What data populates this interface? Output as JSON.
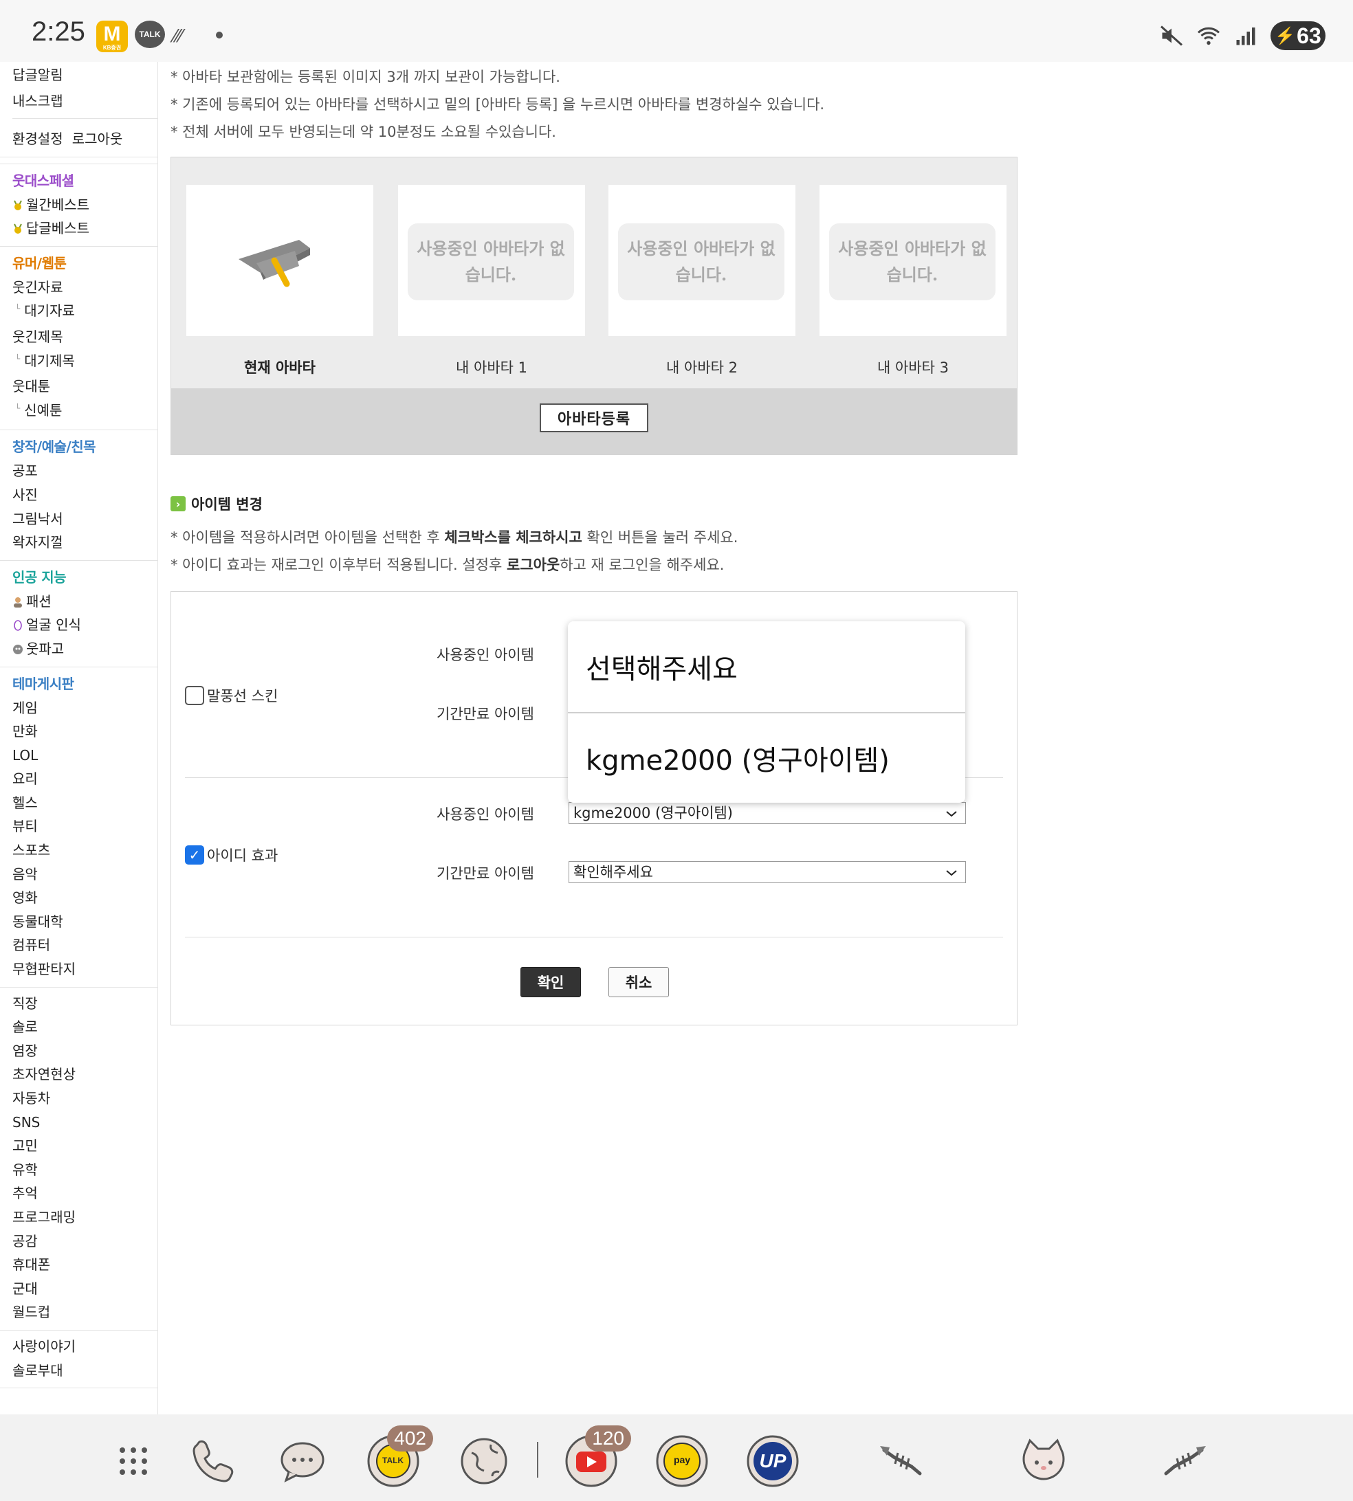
{
  "status_bar": {
    "time": "2:25",
    "kb_app_letter": "M",
    "kb_app_sub": "KB증권",
    "talk_label": "TALK",
    "battery": "63"
  },
  "sidebar": {
    "top_items": [
      "답글알림",
      "내스크랩"
    ],
    "settings": "환경설정",
    "logout": "로그아웃",
    "groups": [
      {
        "title": "웃대스페셜",
        "color": "#9b4dca",
        "items": [
          {
            "label": "월간베스트",
            "icon": "medal-icon"
          },
          {
            "label": "답글베스트",
            "icon": "medal-icon"
          }
        ]
      },
      {
        "title": "유머/웹툰",
        "color": "#e07b00",
        "items": [
          {
            "label": "웃긴자료"
          },
          {
            "label": "대기자료",
            "sub": true
          },
          {
            "label": "웃긴제목"
          },
          {
            "label": "대기제목",
            "sub": true
          },
          {
            "label": "웃대툰"
          },
          {
            "label": "신예툰",
            "sub": true
          }
        ]
      },
      {
        "title": "창작/예술/친목",
        "color": "#3a7fc4",
        "items": [
          {
            "label": "공포"
          },
          {
            "label": "사진"
          },
          {
            "label": "그림낙서"
          },
          {
            "label": "왁자지껄"
          }
        ]
      },
      {
        "title": "인공 지능",
        "color": "#1aa39a",
        "items": [
          {
            "label": "패션",
            "icon": "person-icon"
          },
          {
            "label": "얼굴 인식",
            "icon": "face-outline-icon"
          },
          {
            "label": "웃파고",
            "icon": "robot-icon"
          }
        ]
      },
      {
        "title": "테마게시판",
        "color": "#3a7fc4",
        "items": [
          {
            "label": "게임"
          },
          {
            "label": "만화"
          },
          {
            "label": "LOL"
          },
          {
            "label": "요리"
          },
          {
            "label": "헬스"
          },
          {
            "label": "뷰티"
          },
          {
            "label": "스포츠"
          },
          {
            "label": "음악"
          },
          {
            "label": "영화"
          },
          {
            "label": "동물대학"
          },
          {
            "label": "컴퓨터"
          },
          {
            "label": "무협판타지"
          }
        ]
      },
      {
        "title": "",
        "items": [
          {
            "label": "직장"
          },
          {
            "label": "솔로"
          },
          {
            "label": "염장"
          },
          {
            "label": "초자연현상"
          },
          {
            "label": "자동차"
          },
          {
            "label": "SNS"
          },
          {
            "label": "고민"
          },
          {
            "label": "유학"
          },
          {
            "label": "추억"
          },
          {
            "label": "프로그래밍"
          },
          {
            "label": "공감"
          },
          {
            "label": "휴대폰"
          },
          {
            "label": "군대"
          },
          {
            "label": "월드컵"
          }
        ]
      },
      {
        "title": "",
        "items": [
          {
            "label": "사랑이야기"
          },
          {
            "label": "솔로부대"
          }
        ]
      }
    ]
  },
  "avatar_notes": [
    "* 아바타 보관함에는 등록된 이미지 3개 까지 보관이 가능합니다.",
    "* 기존에 등록되어 있는 아바타를 선택하시고 밑의 [아바타 등록] 을 누르시면 아바타를 변경하실수 있습니다.",
    "* 전체 서버에 모두 반영되는데 약 10분정도 소요될 수있습니다."
  ],
  "avatars": {
    "current_label": "현재 아바타",
    "empty_text": "사용중인 아바타가 없습니다.",
    "slots": [
      "내 아바타 1",
      "내 아바타 2",
      "내 아바타 3"
    ],
    "register_button": "아바타등록"
  },
  "item_section": {
    "title": "아이템 변경",
    "note1_pre": "* 아이템을 적용하시려면 아이템을 선택한 후 ",
    "note1_bold": "체크박스를 체크하시고",
    "note1_post": " 확인 버튼을 눌러 주세요.",
    "note2_pre": "* 아이디 효과는 재로그인 이후부터 적용됩니다. 설정후 ",
    "note2_bold": "로그아웃",
    "note2_post": "하고 재 로그인을 해주세요.",
    "rows": [
      {
        "checkbox_label": "말풍선 스킨",
        "checked": false,
        "in_use_label": "사용중인 아이템",
        "expired_label": "기간만료 아이템"
      },
      {
        "checkbox_label": "아이디 효과",
        "checked": true,
        "in_use_label": "사용중인 아이템",
        "in_use_value": "kgme2000 (영구아이템)",
        "expired_label": "기간만료 아이템",
        "expired_value": "확인해주세요"
      }
    ],
    "confirm_button": "확인",
    "cancel_button": "취소",
    "dropdown_options": [
      "선택해주세요",
      "kgme2000 (영구아이템)"
    ]
  },
  "nav": {
    "talk_badge": "402",
    "youtube_badge": "120",
    "pay_label": "pay",
    "up_label": "UP",
    "talk_label": "TALK"
  }
}
